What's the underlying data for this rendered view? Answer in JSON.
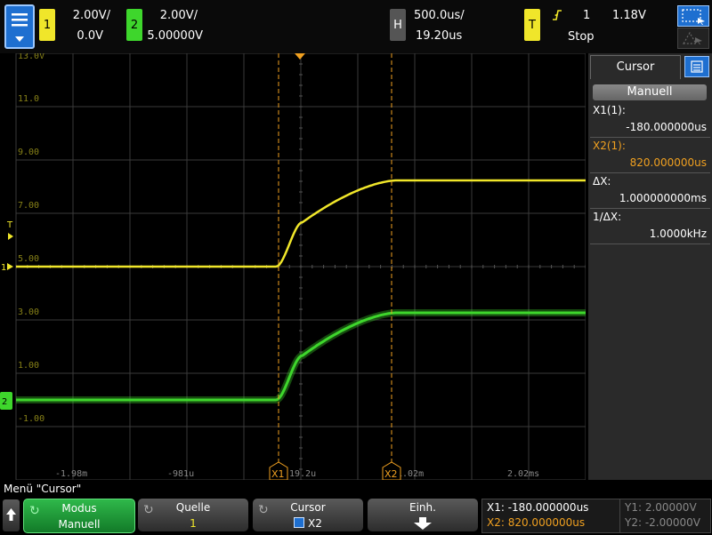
{
  "top": {
    "ch1": {
      "num": "1",
      "scale": "2.00V/",
      "offset": "0.0V",
      "color": "#f0e62a"
    },
    "ch2": {
      "num": "2",
      "scale": "2.00V/",
      "offset": "5.00000V",
      "color": "#3ed62c"
    },
    "horiz": {
      "label": "H",
      "scale": "500.0us/",
      "delay": "19.20us"
    },
    "trig": {
      "label": "T",
      "source": "1",
      "level": "1.18V",
      "state": "Stop"
    }
  },
  "screen": {
    "y_labels": [
      "13.0V",
      "11.0",
      "9.00",
      "7.00",
      "5.00",
      "3.00",
      "1.00",
      "-1.00"
    ],
    "x_labels": [
      "-1.98m",
      "-981u",
      "19.2u",
      "1.02m",
      "2.02ms"
    ],
    "cursor_x1_label": "X1",
    "cursor_x2_label": "X2",
    "trig_marker": "T",
    "ch1_marker": "1",
    "ch2_marker": "2"
  },
  "side": {
    "title": "Cursor",
    "mode_button": "Manuell",
    "x1_label": "X1(1):",
    "x1_value": "-180.000000us",
    "x2_label": "X2(1):",
    "x2_value": "820.000000us",
    "dx_label": "ΔX:",
    "dx_value": "1.000000000ms",
    "inv_dx_label": "1/ΔX:",
    "inv_dx_value": "1.0000kHz"
  },
  "menu_title": "Menü \"Cursor\"",
  "softkeys": {
    "modus": {
      "l1": "Modus",
      "l2": "Manuell"
    },
    "quelle": {
      "l1": "Quelle",
      "l2": "1"
    },
    "cursor": {
      "l1": "Cursor",
      "l2": "X2"
    },
    "einh": {
      "l1": "Einh."
    }
  },
  "readout": {
    "x1": "X1: -180.000000us",
    "x2": "X2: 820.000000us",
    "y1": "Y1: 2.00000V",
    "y2": "Y2: -2.00000V"
  },
  "colors": {
    "ch1": "#f0e62a",
    "ch2": "#3ed62c",
    "cursor": "#f0a020",
    "accent_blue": "#1e6fd0"
  }
}
